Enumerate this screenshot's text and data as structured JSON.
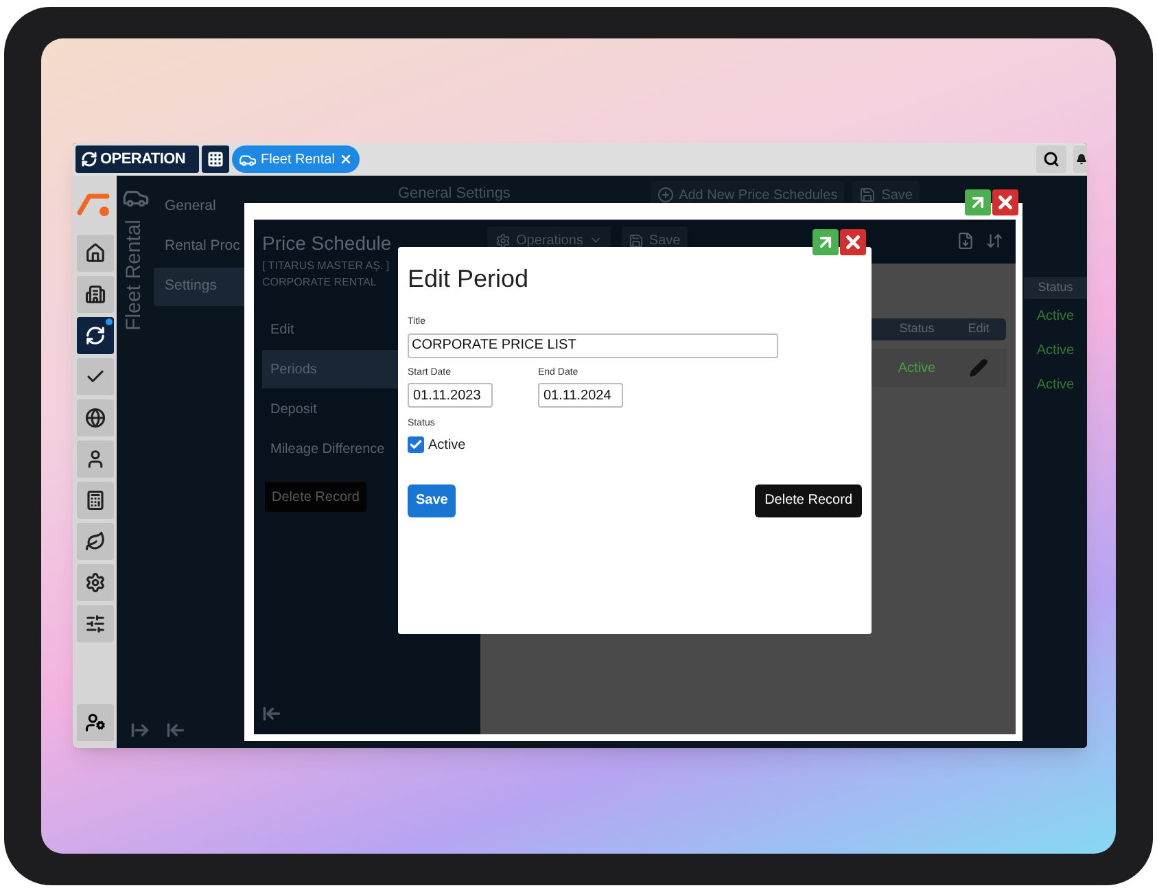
{
  "top_bar": {
    "module_button": "OPERATION",
    "tabs": [
      {
        "label": "Fleet Rental",
        "selected": true
      }
    ]
  },
  "sidebar": {
    "items": [
      {
        "selected": false,
        "notification": false
      },
      {
        "selected": false,
        "notification": false
      },
      {
        "selected": true,
        "notification": true
      },
      {
        "selected": false,
        "notification": false
      },
      {
        "selected": false,
        "notification": false
      },
      {
        "selected": false,
        "notification": false
      },
      {
        "selected": false,
        "notification": false
      },
      {
        "selected": false,
        "notification": false
      },
      {
        "selected": false,
        "notification": false
      },
      {
        "selected": false,
        "notification": false
      }
    ]
  },
  "module_title": "Fleet Rental",
  "menu": [
    {
      "label": "General",
      "selected": false
    },
    {
      "label": "Rental Proc",
      "selected": false
    },
    {
      "label": "Settings",
      "selected": true
    }
  ],
  "content": {
    "header": "General Settings",
    "toolbar": {
      "add": "Add New Price Schedules",
      "save": "Save"
    },
    "table": {
      "columns": [
        "Status"
      ],
      "rows": [
        "Active",
        "Active",
        "Active"
      ]
    }
  },
  "price_schedule_dialog": {
    "title": "Price Schedule",
    "subtitle_lines": [
      "[ TITARUS MASTER AŞ. ]",
      "CORPORATE RENTAL"
    ],
    "menu": [
      {
        "label": "Edit",
        "selected": false
      },
      {
        "label": "Periods",
        "selected": true
      },
      {
        "label": "Deposit",
        "selected": false
      },
      {
        "label": "Mileage Difference",
        "selected": false
      }
    ],
    "delete_button": "Delete Record",
    "toolbar": {
      "operations": "Operations",
      "save": "Save"
    },
    "table": {
      "columns": [
        "Status",
        "Edit"
      ],
      "rows": [
        {
          "status": "Active"
        }
      ]
    }
  },
  "edit_period_dialog": {
    "title": "Edit Period",
    "title_field": {
      "label": "Title",
      "value": "CORPORATE PRICE LIST"
    },
    "start_date": {
      "label": "Start Date",
      "value": "01.11.2023"
    },
    "end_date": {
      "label": "End Date",
      "value": "01.11.2024"
    },
    "status": {
      "label": "Status",
      "option": "Active",
      "checked": true
    },
    "save_button": "Save",
    "delete_button": "Delete Record"
  }
}
